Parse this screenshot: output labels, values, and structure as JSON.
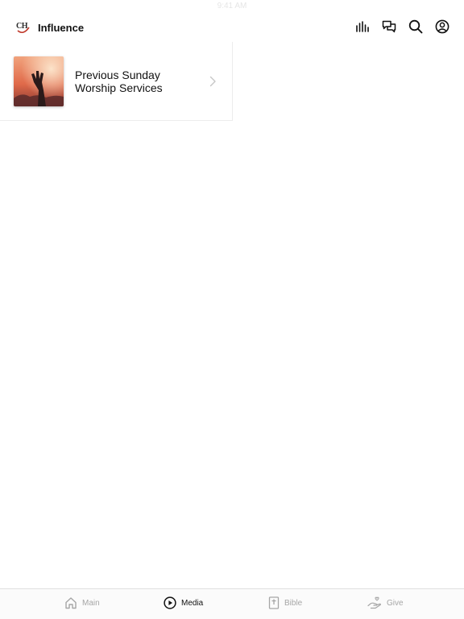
{
  "status_bar": {
    "time": "9:41 AM"
  },
  "header": {
    "logo_text": "CH",
    "title": "Influence",
    "actions": [
      {
        "name": "live-bars-icon"
      },
      {
        "name": "chat-bubbles-icon"
      },
      {
        "name": "search-icon"
      },
      {
        "name": "account-icon"
      }
    ]
  },
  "media": {
    "items": [
      {
        "title": "Previous Sunday Worship Services",
        "thumbnail": "worship-raised-hand-image"
      }
    ]
  },
  "tabs": [
    {
      "label": "Main",
      "icon": "home-icon",
      "active": false
    },
    {
      "label": "Media",
      "icon": "play-circle-icon",
      "active": true
    },
    {
      "label": "Bible",
      "icon": "bible-icon",
      "active": false
    },
    {
      "label": "Give",
      "icon": "giving-hand-icon",
      "active": false
    }
  ],
  "colors": {
    "active_tab": "#111111",
    "inactive_tab": "#a6a6a6",
    "logo_accent": "#c0392b"
  }
}
